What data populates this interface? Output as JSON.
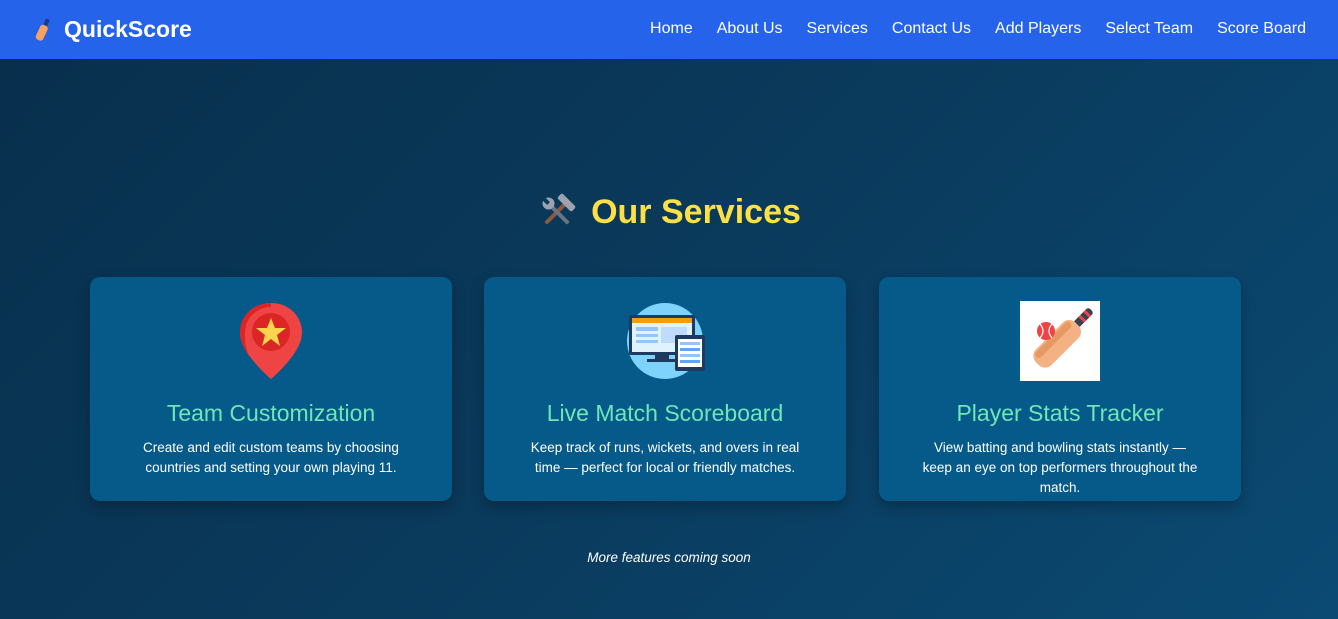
{
  "nav": {
    "brand_name": "QuickScore",
    "brand_icon": "cricket-bat-icon",
    "links": [
      "Home",
      "About Us",
      "Services",
      "Contact Us",
      "Add Players",
      "Select Team",
      "Score Board"
    ]
  },
  "services": {
    "heading_icon": "tools-icon",
    "heading": "Our Services",
    "cards": [
      {
        "icon": "map-pin-star-icon",
        "title": "Team Customization",
        "description": "Create and edit custom teams by choosing countries and setting your own playing 11."
      },
      {
        "icon": "live-scoreboard-monitor-icon",
        "title": "Live Match Scoreboard",
        "description": "Keep track of runs, wickets, and overs in real time — perfect for local or friendly matches."
      },
      {
        "icon": "cricket-bat-ball-icon",
        "title": "Player Stats Tracker",
        "description": "View batting and bowling stats instantly — keep an eye on top performers throughout the match."
      }
    ],
    "footnote": "More features coming soon"
  },
  "colors": {
    "navbar": "#2563eb",
    "heading": "#fde047",
    "card_bg": "#065a8a",
    "card_title": "#6ee7b7"
  }
}
